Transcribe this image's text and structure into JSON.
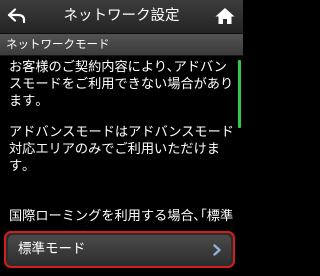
{
  "header": {
    "title": "ネットワーク設定",
    "back_icon": "back-arrow-icon",
    "home_icon": "home-icon"
  },
  "section": {
    "title": "ネットワークモード"
  },
  "content": {
    "paragraphs": [
      "お客様のご契約内容により､アドバンスモードをご利用できない場合があります｡",
      "アドバンスモードはアドバンスモード対応エリアのみでご利用いただけます｡",
      "国際ローミングを利用する場合､｢標準モード｣に設定してください｡"
    ]
  },
  "mode_button": {
    "label": "標準モード",
    "chevron_icon": "chevron-right-icon"
  },
  "colors": {
    "background": "#000000",
    "highlight_border": "#d11e1e",
    "scroll_indicator": "#31c94b",
    "chevron": "#8fb4d8"
  }
}
